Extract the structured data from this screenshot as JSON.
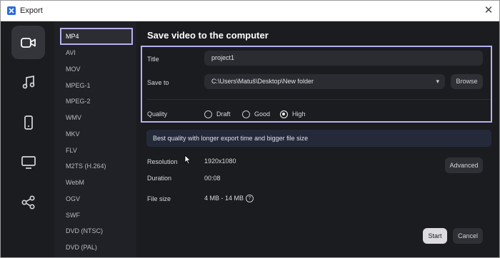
{
  "window": {
    "title": "Export",
    "close_label": "✕"
  },
  "categories": [
    {
      "name": "video-icon",
      "active": true
    },
    {
      "name": "music-icon",
      "active": false
    },
    {
      "name": "phone-icon",
      "active": false
    },
    {
      "name": "monitor-icon",
      "active": false
    },
    {
      "name": "share-icon",
      "active": false
    }
  ],
  "formats": [
    "MP4",
    "AVI",
    "MOV",
    "MPEG-1",
    "MPEG-2",
    "WMV",
    "MKV",
    "FLV",
    "M2TS (H.264)",
    "WebM",
    "OGV",
    "SWF",
    "DVD (NTSC)",
    "DVD (PAL)"
  ],
  "selected_format": "MP4",
  "main": {
    "heading": "Save video to the computer",
    "title_label": "Title",
    "title_value": "project1",
    "save_to_label": "Save to",
    "save_to_value": "C:\\Users\\Matuš\\Desktop\\New folder",
    "browse_label": "Browse",
    "quality_label": "Quality",
    "quality_options": [
      "Draft",
      "Good",
      "High"
    ],
    "quality_selected": "High",
    "hint": "Best quality with longer export time and bigger file size",
    "resolution_label": "Resolution",
    "resolution_value": "1920x1080",
    "duration_label": "Duration",
    "duration_value": "00:08",
    "filesize_label": "File size",
    "filesize_value": "4 MB - 14 MB",
    "advanced_label": "Advanced",
    "start_label": "Start",
    "cancel_label": "Cancel"
  },
  "colors": {
    "highlight": "#b6b1ef",
    "background": "#1b1c20",
    "hint_bg": "#252a3a"
  }
}
